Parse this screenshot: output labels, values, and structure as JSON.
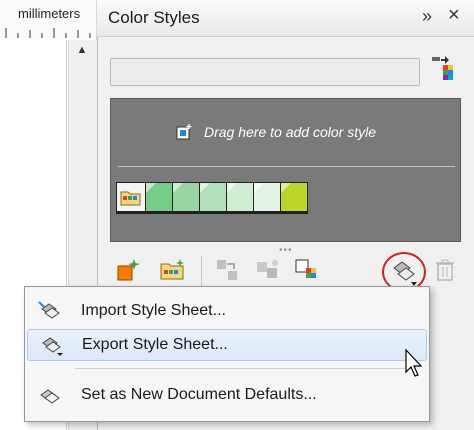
{
  "ruler": {
    "unit_label": "millimeters"
  },
  "docker": {
    "title": "Color Styles",
    "collapse_glyph": "»",
    "close_glyph": "×",
    "name_field_value": "",
    "drop_hint": "Drag here to add color style",
    "harmony_swatches": [
      "#77cc88",
      "#99d6a3",
      "#b3e0bb",
      "#cdeed2",
      "#e3f4e6",
      "#bdd428"
    ]
  },
  "toolbar": {
    "icons": [
      "new-color-style-icon",
      "new-harmony-icon",
      "apply-color-icon",
      "convert-to-harmony-icon",
      "color-palette-icon",
      "import-export-icon",
      "delete-icon"
    ]
  },
  "context_menu": {
    "items": [
      {
        "label": "Import Style Sheet...",
        "icon": "import-style-sheet-icon",
        "highlighted": false
      },
      {
        "label": "Export Style Sheet...",
        "icon": "export-style-sheet-icon",
        "highlighted": true
      },
      {
        "label": "Set as New Document Defaults...",
        "icon": "document-defaults-icon",
        "highlighted": false
      }
    ]
  },
  "colors": {
    "accent_circle": "#cc2222",
    "menu_highlight": "#dbe8f7",
    "drop_area": "#7a7a7a"
  }
}
